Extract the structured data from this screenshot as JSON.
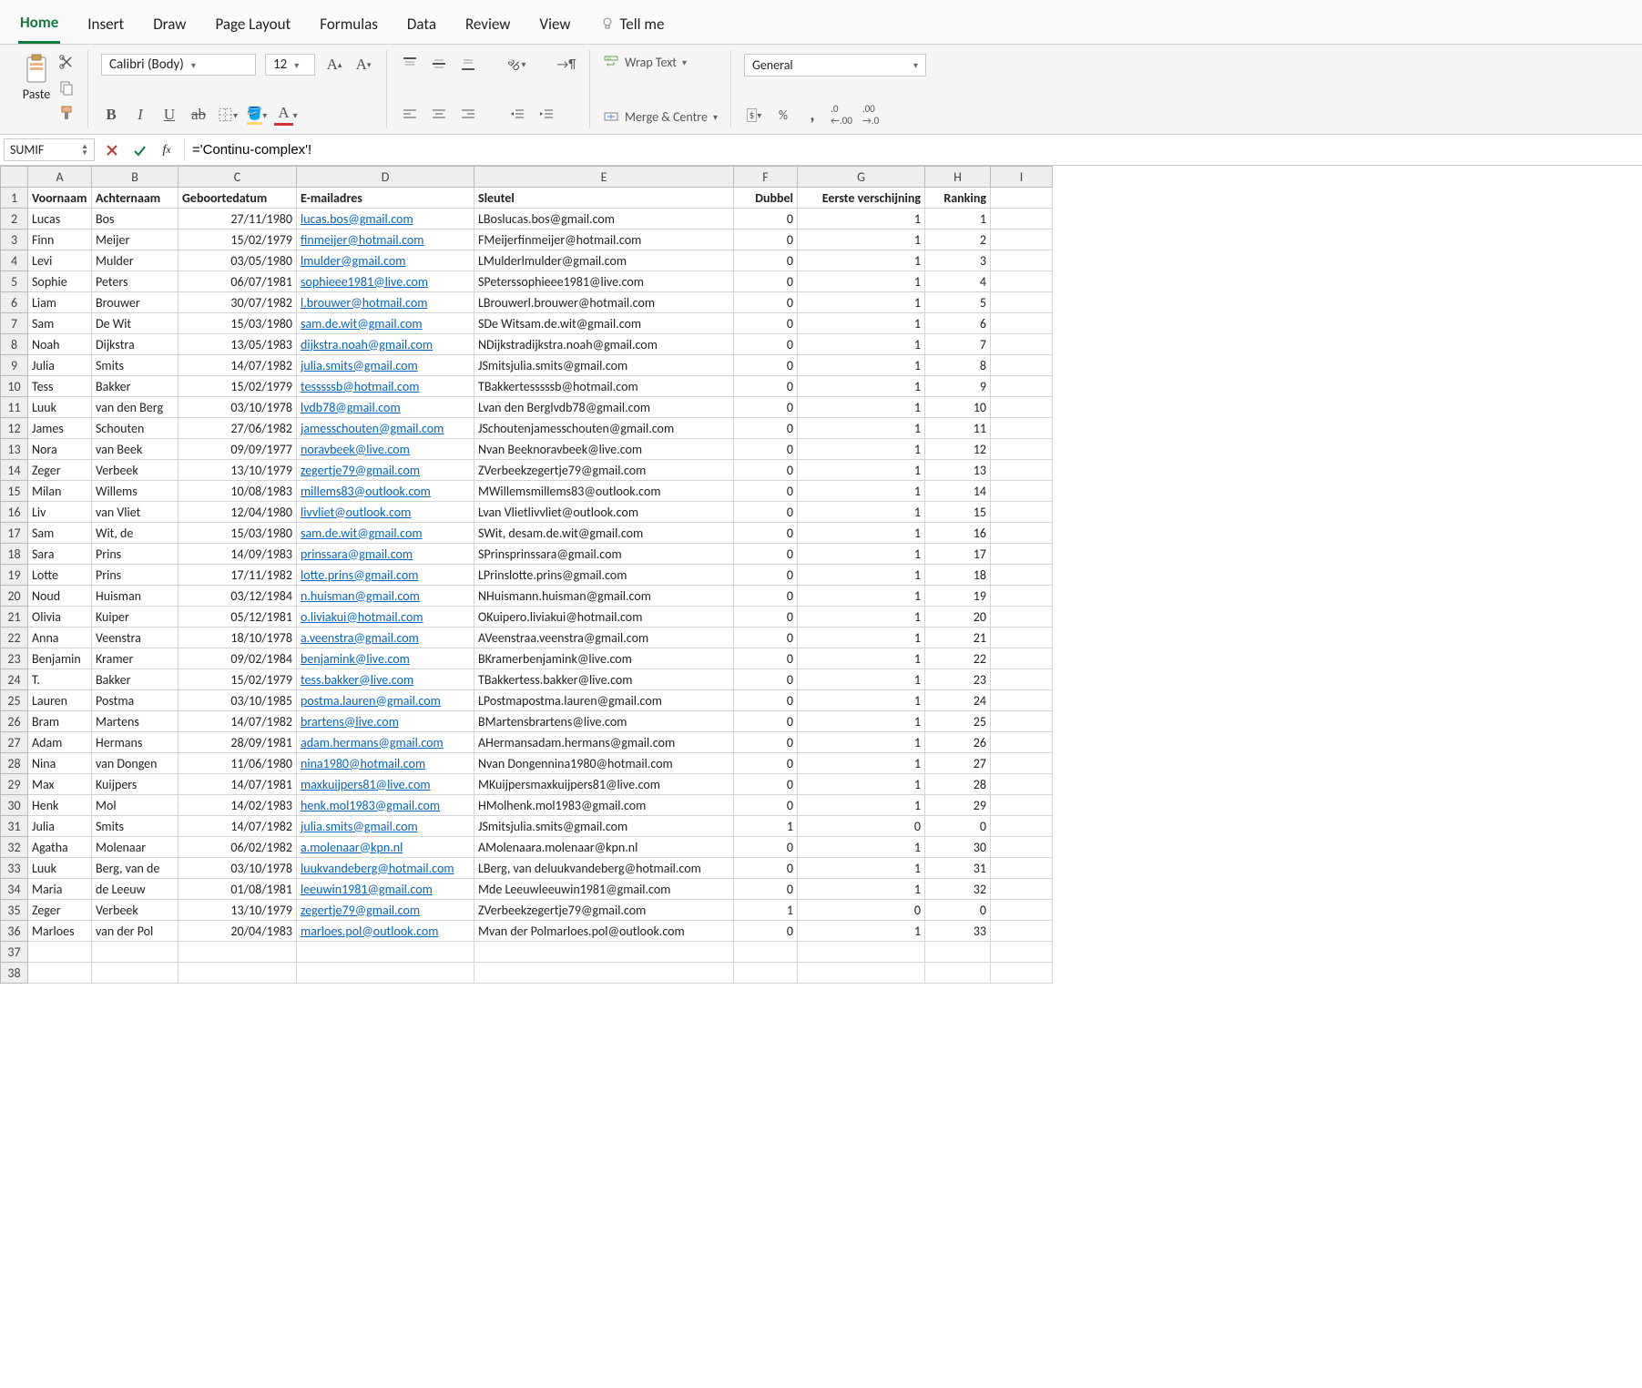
{
  "tabs": [
    "Home",
    "Insert",
    "Draw",
    "Page Layout",
    "Formulas",
    "Data",
    "Review",
    "View"
  ],
  "active_tab": "Home",
  "tellme": "Tell me",
  "clipboard": {
    "paste": "Paste"
  },
  "font": {
    "name": "Calibri (Body)",
    "size": "12"
  },
  "alignment": {
    "wrap": "Wrap Text",
    "merge": "Merge & Centre"
  },
  "number": {
    "format": "General"
  },
  "namebox": "SUMIF",
  "formula": "='Continu-complex'!",
  "headers": [
    "Voornaam",
    "Achternaam",
    "Geboortedatum",
    "E-mailadres",
    "Sleutel",
    "Dubbel",
    "Eerste verschijning",
    "Ranking"
  ],
  "col_letters": [
    "A",
    "B",
    "C",
    "D",
    "E",
    "F",
    "G",
    "H",
    "I"
  ],
  "rows": [
    {
      "voor": "Lucas",
      "achter": "Bos",
      "geb": "27/11/1980",
      "email": "lucas.bos@gmail.com",
      "sleutel": "LBoslucas.bos@gmail.com",
      "dubbel": 0,
      "eerste": 1,
      "rank": 1
    },
    {
      "voor": "Finn",
      "achter": "Meijer",
      "geb": "15/02/1979",
      "email": "finmeijer@hotmail.com",
      "sleutel": "FMeijerfinmeijer@hotmail.com",
      "dubbel": 0,
      "eerste": 1,
      "rank": 2
    },
    {
      "voor": "Levi",
      "achter": "Mulder",
      "geb": "03/05/1980",
      "email": "lmulder@gmail.com",
      "sleutel": "LMulderlmulder@gmail.com",
      "dubbel": 0,
      "eerste": 1,
      "rank": 3
    },
    {
      "voor": "Sophie",
      "achter": "Peters",
      "geb": "06/07/1981",
      "email": "sophieee1981@live.com",
      "sleutel": "SPeterssophieee1981@live.com",
      "dubbel": 0,
      "eerste": 1,
      "rank": 4
    },
    {
      "voor": "Liam",
      "achter": "Brouwer",
      "geb": "30/07/1982",
      "email": "l.brouwer@hotmail.com",
      "sleutel": "LBrouwerl.brouwer@hotmail.com",
      "dubbel": 0,
      "eerste": 1,
      "rank": 5
    },
    {
      "voor": "Sam",
      "achter": "De Wit",
      "geb": "15/03/1980",
      "email": "sam.de.wit@gmail.com",
      "sleutel": "SDe Witsam.de.wit@gmail.com",
      "dubbel": 0,
      "eerste": 1,
      "rank": 6
    },
    {
      "voor": "Noah",
      "achter": "Dijkstra",
      "geb": "13/05/1983",
      "email": "dijkstra.noah@gmail.com",
      "sleutel": "NDijkstradijkstra.noah@gmail.com",
      "dubbel": 0,
      "eerste": 1,
      "rank": 7
    },
    {
      "voor": "Julia",
      "achter": "Smits",
      "geb": "14/07/1982",
      "email": "julia.smits@gmail.com",
      "sleutel": "JSmitsjulia.smits@gmail.com",
      "dubbel": 0,
      "eerste": 1,
      "rank": 8
    },
    {
      "voor": "Tess",
      "achter": "Bakker",
      "geb": "15/02/1979",
      "email": "tesssssb@hotmail.com",
      "sleutel": "TBakkertesssssb@hotmail.com",
      "dubbel": 0,
      "eerste": 1,
      "rank": 9
    },
    {
      "voor": "Luuk",
      "achter": "van den Berg",
      "geb": "03/10/1978",
      "email": "lvdb78@gmail.com",
      "sleutel": "Lvan den Berglvdb78@gmail.com",
      "dubbel": 0,
      "eerste": 1,
      "rank": 10
    },
    {
      "voor": "James",
      "achter": "Schouten",
      "geb": "27/06/1982",
      "email": "jamesschouten@gmail.com",
      "sleutel": "JSchoutenjamesschouten@gmail.com",
      "dubbel": 0,
      "eerste": 1,
      "rank": 11
    },
    {
      "voor": "Nora",
      "achter": "van Beek",
      "geb": "09/09/1977",
      "email": "noravbeek@live.com",
      "sleutel": "Nvan Beeknoravbeek@live.com",
      "dubbel": 0,
      "eerste": 1,
      "rank": 12
    },
    {
      "voor": "Zeger",
      "achter": "Verbeek",
      "geb": "13/10/1979",
      "email": "zegertje79@gmail.com",
      "sleutel": "ZVerbeekzegertje79@gmail.com",
      "dubbel": 0,
      "eerste": 1,
      "rank": 13
    },
    {
      "voor": "Milan",
      "achter": "Willems",
      "geb": "10/08/1983",
      "email": "millems83@outlook.com",
      "sleutel": "MWillemsmillems83@outlook.com",
      "dubbel": 0,
      "eerste": 1,
      "rank": 14
    },
    {
      "voor": "Liv",
      "achter": "van Vliet",
      "geb": "12/04/1980",
      "email": "livvliet@outlook.com",
      "sleutel": "Lvan Vlietlivvliet@outlook.com",
      "dubbel": 0,
      "eerste": 1,
      "rank": 15
    },
    {
      "voor": "Sam",
      "achter": "Wit, de",
      "geb": "15/03/1980",
      "email": "sam.de.wit@gmail.com",
      "sleutel": "SWit, desam.de.wit@gmail.com",
      "dubbel": 0,
      "eerste": 1,
      "rank": 16
    },
    {
      "voor": "Sara",
      "achter": "Prins",
      "geb": "14/09/1983",
      "email": "prinssara@gmail.com",
      "sleutel": "SPrinsprinssara@gmail.com",
      "dubbel": 0,
      "eerste": 1,
      "rank": 17
    },
    {
      "voor": "Lotte",
      "achter": "Prins",
      "geb": "17/11/1982",
      "email": "lotte.prins@gmail.com",
      "sleutel": "LPrinslotte.prins@gmail.com",
      "dubbel": 0,
      "eerste": 1,
      "rank": 18
    },
    {
      "voor": "Noud",
      "achter": "Huisman",
      "geb": "03/12/1984",
      "email": "n.huisman@gmail.com",
      "sleutel": "NHuismann.huisman@gmail.com",
      "dubbel": 0,
      "eerste": 1,
      "rank": 19
    },
    {
      "voor": "Olivia",
      "achter": "Kuiper",
      "geb": "05/12/1981",
      "email": "o.liviakui@hotmail.com",
      "sleutel": "OKuipero.liviakui@hotmail.com",
      "dubbel": 0,
      "eerste": 1,
      "rank": 20
    },
    {
      "voor": "Anna",
      "achter": "Veenstra",
      "geb": "18/10/1978",
      "email": "a.veenstra@gmail.com",
      "sleutel": "AVeenstraa.veenstra@gmail.com",
      "dubbel": 0,
      "eerste": 1,
      "rank": 21
    },
    {
      "voor": "Benjamin",
      "achter": "Kramer",
      "geb": "09/02/1984",
      "email": "benjamink@live.com",
      "sleutel": "BKramerbenjamink@live.com",
      "dubbel": 0,
      "eerste": 1,
      "rank": 22
    },
    {
      "voor": "T.",
      "achter": "Bakker",
      "geb": "15/02/1979",
      "email": "tess.bakker@live.com",
      "sleutel": "TBakkertess.bakker@live.com",
      "dubbel": 0,
      "eerste": 1,
      "rank": 23
    },
    {
      "voor": "Lauren",
      "achter": "Postma",
      "geb": "03/10/1985",
      "email": "postma.lauren@gmail.com",
      "sleutel": "LPostmapostma.lauren@gmail.com",
      "dubbel": 0,
      "eerste": 1,
      "rank": 24
    },
    {
      "voor": "Bram",
      "achter": "Martens",
      "geb": "14/07/1982",
      "email": "brartens@live.com",
      "sleutel": "BMartensbrartens@live.com",
      "dubbel": 0,
      "eerste": 1,
      "rank": 25
    },
    {
      "voor": "Adam",
      "achter": "Hermans",
      "geb": "28/09/1981",
      "email": "adam.hermans@gmail.com",
      "sleutel": "AHermansadam.hermans@gmail.com",
      "dubbel": 0,
      "eerste": 1,
      "rank": 26
    },
    {
      "voor": "Nina",
      "achter": "van Dongen",
      "geb": "11/06/1980",
      "email": "nina1980@hotmail.com",
      "sleutel": "Nvan Dongennina1980@hotmail.com",
      "dubbel": 0,
      "eerste": 1,
      "rank": 27
    },
    {
      "voor": "Max",
      "achter": "Kuijpers",
      "geb": "14/07/1981",
      "email": "maxkuijpers81@live.com",
      "sleutel": "MKuijpersmaxkuijpers81@live.com",
      "dubbel": 0,
      "eerste": 1,
      "rank": 28
    },
    {
      "voor": "Henk",
      "achter": "Mol",
      "geb": "14/02/1983",
      "email": "henk.mol1983@gmail.com",
      "sleutel": "HMolhenk.mol1983@gmail.com",
      "dubbel": 0,
      "eerste": 1,
      "rank": 29
    },
    {
      "voor": "Julia",
      "achter": "Smits",
      "geb": "14/07/1982",
      "email": "julia.smits@gmail.com",
      "sleutel": "JSmitsjulia.smits@gmail.com",
      "dubbel": 1,
      "eerste": 0,
      "rank": 0
    },
    {
      "voor": "Agatha",
      "achter": "Molenaar",
      "geb": "06/02/1982",
      "email": "a.molenaar@kpn.nl",
      "sleutel": "AMolenaara.molenaar@kpn.nl",
      "dubbel": 0,
      "eerste": 1,
      "rank": 30
    },
    {
      "voor": "Luuk",
      "achter": "Berg, van de",
      "geb": "03/10/1978",
      "email": "luukvandeberg@hotmail.com",
      "sleutel": "LBerg, van deluukvandeberg@hotmail.com",
      "dubbel": 0,
      "eerste": 1,
      "rank": 31
    },
    {
      "voor": "Maria",
      "achter": "de Leeuw",
      "geb": "01/08/1981",
      "email": "leeuwin1981@gmail.com",
      "sleutel": "Mde Leeuwleeuwin1981@gmail.com",
      "dubbel": 0,
      "eerste": 1,
      "rank": 32
    },
    {
      "voor": "Zeger",
      "achter": "Verbeek",
      "geb": "13/10/1979",
      "email": "zegertje79@gmail.com",
      "sleutel": "ZVerbeekzegertje79@gmail.com",
      "dubbel": 1,
      "eerste": 0,
      "rank": 0
    },
    {
      "voor": "Marloes",
      "achter": "van der Pol",
      "geb": "20/04/1983",
      "email": "marloes.pol@outlook.com",
      "sleutel": "Mvan der Polmarloes.pol@outlook.com",
      "dubbel": 0,
      "eerste": 1,
      "rank": 33
    }
  ],
  "empty_rows": [
    37,
    38
  ]
}
